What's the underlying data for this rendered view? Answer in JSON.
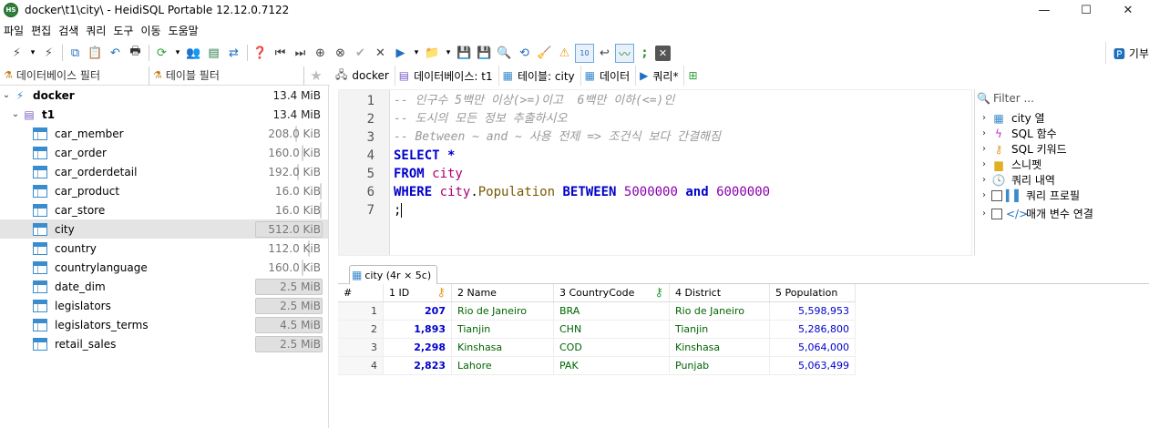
{
  "window": {
    "app_icon_text": "HS",
    "title": "docker\\t1\\city\\ - HeidiSQL Portable 12.12.0.7122",
    "controls": [
      "—",
      "☐",
      "✕"
    ]
  },
  "menu": [
    "파일",
    "편집",
    "검색",
    "쿼리",
    "도구",
    "이동",
    "도움말"
  ],
  "toolbar": {
    "right_label": "기부"
  },
  "left_filters": {
    "db_filter": "데이터베이스 필터",
    "table_filter": "테이블 필터"
  },
  "tree": {
    "root": {
      "label": "docker",
      "size": "13.4 MiB"
    },
    "db": {
      "label": "t1",
      "size": "13.4 MiB"
    },
    "tables": [
      {
        "name": "car_member",
        "size": "208.0 KiB",
        "fill": 0.41
      },
      {
        "name": "car_order",
        "size": "160.0 KiB",
        "fill": 0.31
      },
      {
        "name": "car_orderdetail",
        "size": "192.0 KiB",
        "fill": 0.38
      },
      {
        "name": "car_product",
        "size": "16.0 KiB",
        "fill": 0.03
      },
      {
        "name": "car_store",
        "size": "16.0 KiB",
        "fill": 0.03
      },
      {
        "name": "city",
        "size": "512.0 KiB",
        "fill": 1.0
      },
      {
        "name": "country",
        "size": "112.0 KiB",
        "fill": 0.22
      },
      {
        "name": "countrylanguage",
        "size": "160.0 KiB",
        "fill": 0.31
      },
      {
        "name": "date_dim",
        "size": "2.5 MiB",
        "fill": 1.0
      },
      {
        "name": "legislators",
        "size": "2.5 MiB",
        "fill": 1.0
      },
      {
        "name": "legislators_terms",
        "size": "4.5 MiB",
        "fill": 1.0
      },
      {
        "name": "retail_sales",
        "size": "2.5 MiB",
        "fill": 1.0
      }
    ],
    "selected": "city"
  },
  "tabs": [
    {
      "label": "docker"
    },
    {
      "label": "데이터베이스: t1"
    },
    {
      "label": "테이블: city"
    },
    {
      "label": "데이터"
    },
    {
      "label": "쿼리*"
    }
  ],
  "editor": {
    "line_numbers": [
      "1",
      "2",
      "3",
      "4",
      "5",
      "6",
      "7"
    ],
    "comments": [
      "-- 인구수 5백만 이상(>=)이고  6백만 이하(<=)인",
      "-- 도시의 모든 정보 추출하시오",
      "-- Between ~ and ~ 사용 전제 => 조건식 보다 간결해짐"
    ],
    "select_kw": "SELECT",
    "star": " *",
    "from_kw": "FROM",
    "from_table": " city",
    "where_kw": "WHERE",
    "where_table": " city",
    "dot": ".",
    "where_col": "Population",
    "between_kw": " BETWEEN",
    "val1": " 5000000",
    "and_kw": " and",
    "val2": " 6000000",
    "end": ";"
  },
  "helper": {
    "filter_placeholder": "Filter ...",
    "items": [
      {
        "label": "city 열"
      },
      {
        "label": "SQL 함수"
      },
      {
        "label": "SQL 키워드"
      },
      {
        "label": "스니펫"
      },
      {
        "label": "쿼리 내역"
      },
      {
        "label": "쿼리 프로필"
      },
      {
        "label": "매개 변수 연결"
      }
    ]
  },
  "result_tab": "city (4r × 5c)",
  "grid": {
    "columns": [
      "#",
      "1 ID",
      "2 Name",
      "3 CountryCode",
      "4 District",
      "5 Population"
    ],
    "rows": [
      [
        "1",
        "207",
        "Rio de Janeiro",
        "BRA",
        "Rio de Janeiro",
        "5,598,953"
      ],
      [
        "2",
        "1,893",
        "Tianjin",
        "CHN",
        "Tianjin",
        "5,286,800"
      ],
      [
        "3",
        "2,298",
        "Kinshasa",
        "COD",
        "Kinshasa",
        "5,064,000"
      ],
      [
        "4",
        "2,823",
        "Lahore",
        "PAK",
        "Punjab",
        "5,063,499"
      ]
    ]
  }
}
